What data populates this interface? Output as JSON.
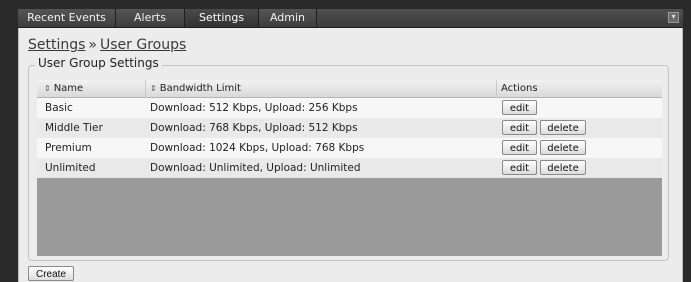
{
  "tabs": [
    {
      "label": "Recent Events"
    },
    {
      "label": "Alerts"
    },
    {
      "label": "Settings"
    },
    {
      "label": "Admin"
    }
  ],
  "active_tab": "Settings",
  "menu_icon": "chevron-down-icon",
  "breadcrumb": {
    "root": "Settings",
    "separator": "»",
    "current": "User Groups"
  },
  "section": {
    "legend": "User Group Settings"
  },
  "table": {
    "columns": [
      "Name",
      "Bandwidth Limit",
      "Actions"
    ],
    "sort_icon": "sort-icon",
    "rows": [
      {
        "name": "Basic",
        "bandwidth": "Download: 512 Kbps, Upload: 256 Kbps",
        "edit": "edit"
      },
      {
        "name": "Middle Tier",
        "bandwidth": "Download: 768 Kbps, Upload: 512 Kbps",
        "edit": "edit",
        "delete": "delete"
      },
      {
        "name": "Premium",
        "bandwidth": "Download: 1024 Kbps, Upload: 768 Kbps",
        "edit": "edit",
        "delete": "delete"
      },
      {
        "name": "Unlimited",
        "bandwidth": "Download: Unlimited, Upload: Unlimited",
        "edit": "edit",
        "delete": "delete"
      }
    ]
  },
  "create_label": "Create"
}
